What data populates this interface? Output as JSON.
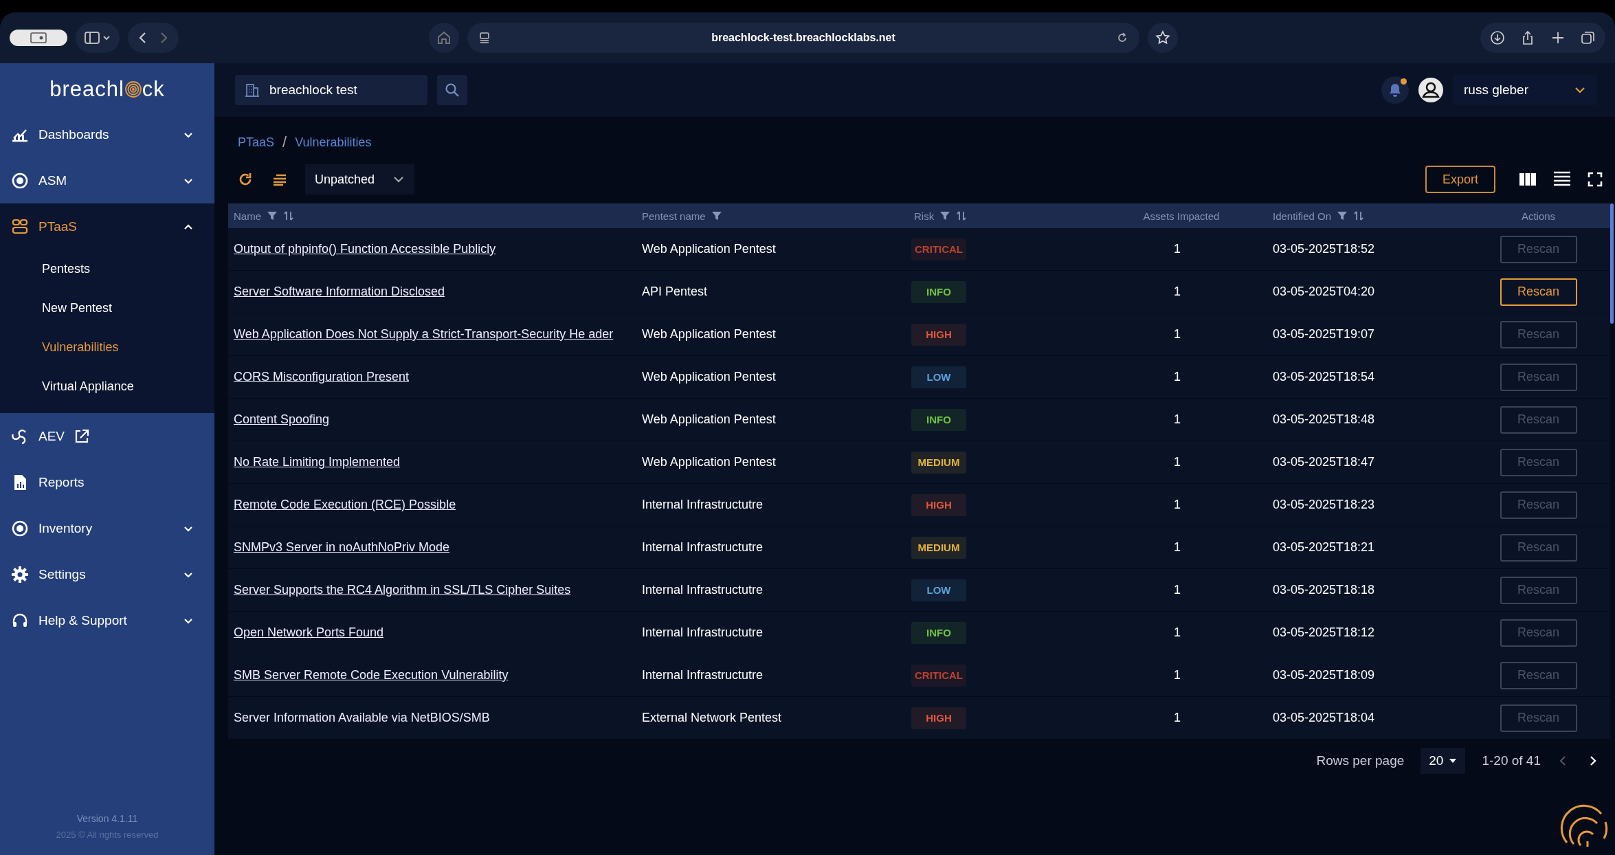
{
  "browser": {
    "url": "breachlock-test.breachlocklabs.net"
  },
  "sidebar": {
    "logo_parts": [
      "breachl",
      "ck"
    ],
    "items": [
      {
        "label": "Dashboards",
        "kind": "group",
        "expanded": false,
        "selected": false
      },
      {
        "label": "ASM",
        "kind": "group",
        "expanded": false,
        "selected": false
      },
      {
        "label": "PTaaS",
        "kind": "group",
        "expanded": true,
        "selected": true,
        "children": [
          {
            "label": "Pentests",
            "selected": false
          },
          {
            "label": "New Pentest",
            "selected": false
          },
          {
            "label": "Vulnerabilities",
            "selected": true
          },
          {
            "label": "Virtual Appliance",
            "selected": false
          }
        ]
      },
      {
        "label": "AEV",
        "kind": "external",
        "selected": false
      },
      {
        "label": "Reports",
        "kind": "link",
        "selected": false
      },
      {
        "label": "Inventory",
        "kind": "group",
        "expanded": false,
        "selected": false
      },
      {
        "label": "Settings",
        "kind": "group",
        "expanded": false,
        "selected": false
      },
      {
        "label": "Help & Support",
        "kind": "group",
        "expanded": false,
        "selected": false
      }
    ],
    "version": "Version 4.1.11",
    "copyright": "2025 © All rights reserved"
  },
  "header": {
    "organization": "breachlock test",
    "notification_dot": true,
    "user": "russ gleber"
  },
  "breadcrumb": {
    "separator": "/",
    "items": [
      "PTaaS",
      "Vulnerabilities"
    ]
  },
  "toolbar": {
    "status_filter": "Unpatched",
    "export": "Export"
  },
  "table": {
    "columns": [
      {
        "label": "Name",
        "filter": true,
        "sort": true
      },
      {
        "label": "Pentest name",
        "filter": true,
        "sort": false
      },
      {
        "label": "Risk",
        "filter": true,
        "sort": true
      },
      {
        "label": "Assets Impacted",
        "filter": false,
        "sort": false
      },
      {
        "label": "Identified On",
        "filter": true,
        "sort": true
      },
      {
        "label": "Actions",
        "filter": false,
        "sort": false
      }
    ],
    "rows": [
      {
        "name": "Output of phpinfo() Function Accessible Publicly",
        "pentest": "Web Application Pentest",
        "risk": "CRITICAL",
        "color": "#b8432e",
        "assets": "1",
        "identified": "03-05-2025T18:52",
        "action": "Rescan",
        "disabled": true
      },
      {
        "name": "Server Software Information Disclosed",
        "pentest": "API Pentest",
        "risk": "INFO",
        "color": "#6fc23f",
        "assets": "1",
        "identified": "03-05-2025T04:20",
        "action": "Rescan",
        "disabled": false
      },
      {
        "name": "Web Application Does Not Supply a Strict-Transport-Security He ader",
        "pentest": "Web Application Pentest",
        "risk": "HIGH",
        "color": "#e0583a",
        "assets": "1",
        "identified": "03-05-2025T19:07",
        "action": "Rescan",
        "disabled": true
      },
      {
        "name": "CORS Misconfiguration Present",
        "pentest": "Web Application Pentest",
        "risk": "LOW",
        "color": "#5aa0d8",
        "assets": "1",
        "identified": "03-05-2025T18:54",
        "action": "Rescan",
        "disabled": true
      },
      {
        "name": "Content Spoofing",
        "pentest": "Web Application Pentest",
        "risk": "INFO",
        "color": "#6fc23f",
        "assets": "1",
        "identified": "03-05-2025T18:48",
        "action": "Rescan",
        "disabled": true
      },
      {
        "name": "No Rate Limiting Implemented",
        "pentest": "Web Application Pentest",
        "risk": "MEDIUM",
        "color": "#e0b23a",
        "assets": "1",
        "identified": "03-05-2025T18:47",
        "action": "Rescan",
        "disabled": true
      },
      {
        "name": "Remote Code Execution (RCE) Possible",
        "pentest": "Internal Infrastructutre",
        "risk": "HIGH",
        "color": "#e0583a",
        "assets": "1",
        "identified": "03-05-2025T18:23",
        "action": "Rescan",
        "disabled": true
      },
      {
        "name": "SNMPv3 Server in noAuthNoPriv Mode",
        "pentest": "Internal Infrastructutre",
        "risk": "MEDIUM",
        "color": "#e0b23a",
        "assets": "1",
        "identified": "03-05-2025T18:21",
        "action": "Rescan",
        "disabled": true
      },
      {
        "name": "Server Supports the RC4 Algorithm in SSL/TLS Cipher Suites",
        "pentest": "Internal Infrastructutre",
        "risk": "LOW",
        "color": "#5aa0d8",
        "assets": "1",
        "identified": "03-05-2025T18:18",
        "action": "Rescan",
        "disabled": true
      },
      {
        "name": "Open Network Ports Found",
        "pentest": "Internal Infrastructutre",
        "risk": "INFO",
        "color": "#6fc23f",
        "assets": "1",
        "identified": "03-05-2025T18:12",
        "action": "Rescan",
        "disabled": true
      },
      {
        "name": "SMB Server Remote Code Execution Vulnerability",
        "pentest": "Internal Infrastructutre",
        "risk": "CRITICAL",
        "color": "#b8432e",
        "assets": "1",
        "identified": "03-05-2025T18:09",
        "action": "Rescan",
        "disabled": true
      },
      {
        "name": "Server Information Available via NetBIOS/SMB",
        "pentest": "External Network Pentest",
        "risk": "HIGH",
        "color": "#e0583a",
        "assets": "1",
        "identified": "03-05-2025T18:04",
        "action": "Rescan",
        "disabled": true
      }
    ]
  },
  "pagination": {
    "rows_per_page_label": "Rows per page",
    "rows_per_page": "20",
    "range": "1-20 of 41"
  }
}
